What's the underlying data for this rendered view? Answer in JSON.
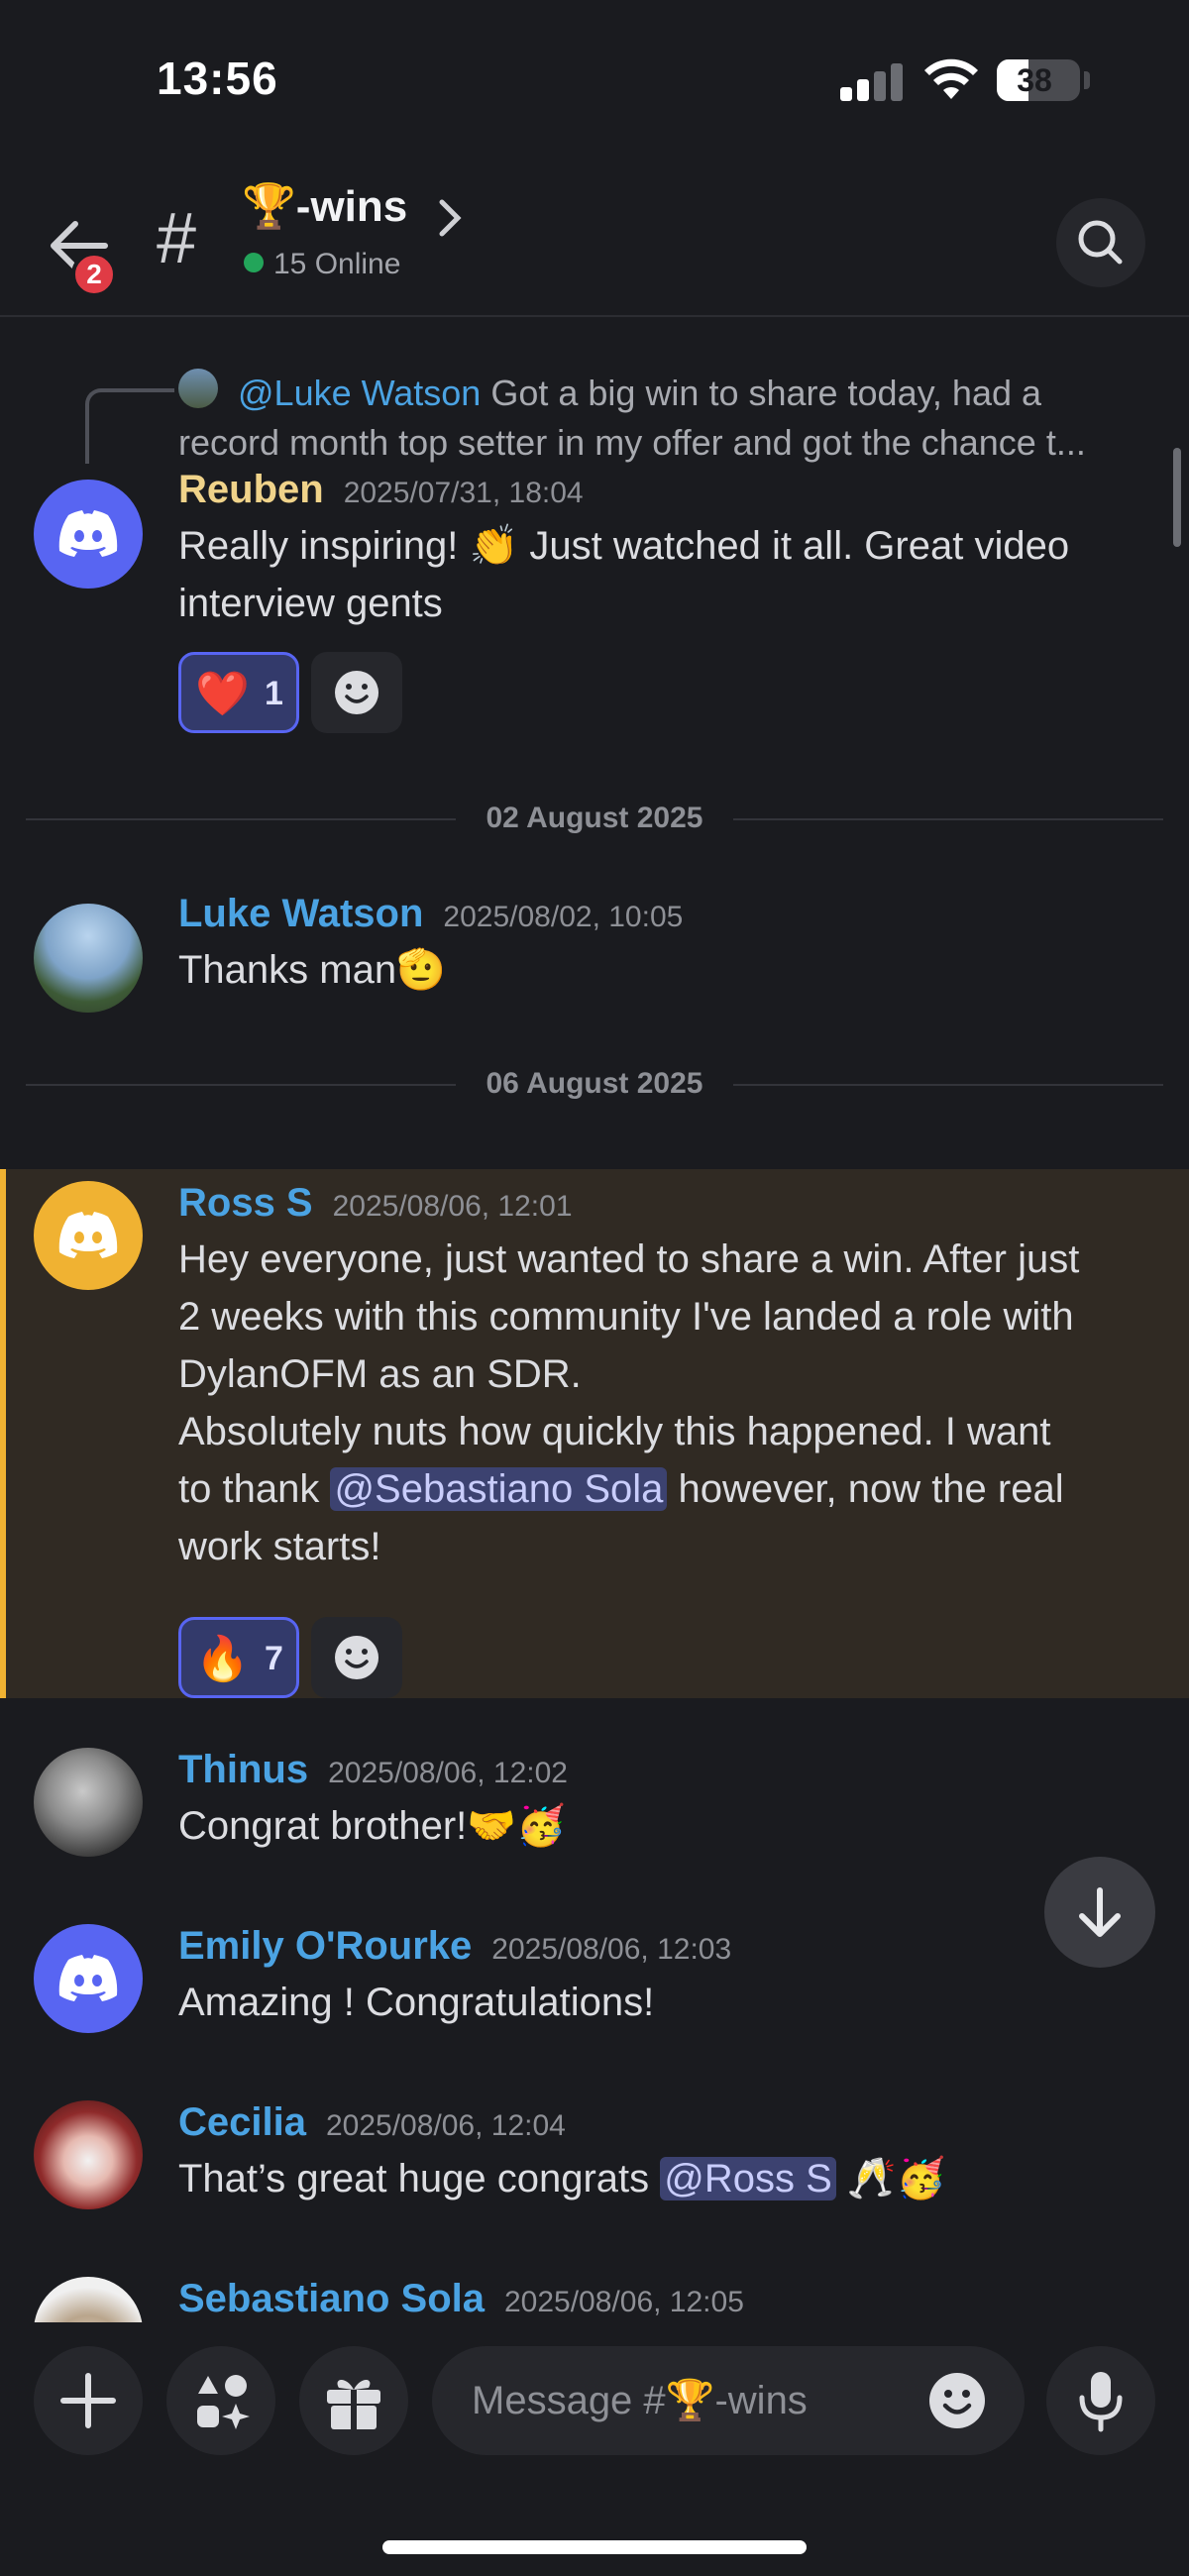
{
  "status_bar": {
    "time": "13:56",
    "battery": "38",
    "battery_level": 0.38
  },
  "header": {
    "unread_badge": "2",
    "hash": "#",
    "channel_name": "🏆-wins",
    "online_count": "15 Online"
  },
  "reply_preview": {
    "mention": "@Luke Watson",
    "text_line1": "Got a big win to share today, had a",
    "text_line2": "record month top setter in my offer and got the chance t..."
  },
  "messages": [
    {
      "author": "Reuben",
      "timestamp": "2025/07/31, 18:04",
      "line1": "Really inspiring! 👏 Just watched it all. Great video",
      "line2": "interview gents",
      "reaction_emoji": "❤️",
      "reaction_count": "1"
    },
    {
      "author": "Luke Watson",
      "timestamp": "2025/08/02, 10:05",
      "line1": "Thanks man🫡"
    },
    {
      "author": "Ross S",
      "timestamp": "2025/08/06, 12:01",
      "line1": "Hey everyone, just wanted to share a win. After just",
      "line2": "2 weeks with this community I've landed a role with",
      "line3": "DylanOFM as an SDR.",
      "line4": "Absolutely nuts how quickly this happened. I want",
      "line5_pre": "to thank ",
      "line5_mention": "@Sebastiano Sola",
      "line5_post": " however, now the real",
      "line6": "work starts!",
      "reaction_emoji": "🔥",
      "reaction_count": "7"
    },
    {
      "author": "Thinus",
      "timestamp": "2025/08/06, 12:02",
      "line1": "Congrat brother!🤝🥳"
    },
    {
      "author": "Emily O'Rourke",
      "timestamp": "2025/08/06, 12:03",
      "line1": "Amazing ! Congratulations!"
    },
    {
      "author": "Cecilia",
      "timestamp": "2025/08/06, 12:04",
      "line1_pre": "That’s great huge congrats ",
      "line1_mention": "@Ross S",
      "line1_post": " 🥂🥳"
    },
    {
      "author": "Sebastiano Sola",
      "timestamp": "2025/08/06, 12:05"
    }
  ],
  "dividers": [
    "02 August 2025",
    "06 August 2025"
  ],
  "composer": {
    "placeholder": "Message #🏆-wins"
  },
  "icons": {
    "back": "arrow-left-icon",
    "search": "search-icon",
    "add": "plus-icon",
    "apps": "apps-icon",
    "gift": "gift-icon",
    "emoji": "emoji-icon",
    "mic": "microphone-icon",
    "jump": "arrow-down-icon"
  },
  "colors": {
    "accent": "#5865f2",
    "online": "#23a55a",
    "badge": "#e03b45",
    "highlight_border": "#f0b232",
    "username_blue": "#4ba3e3",
    "username_yellow": "#f0d38a"
  }
}
